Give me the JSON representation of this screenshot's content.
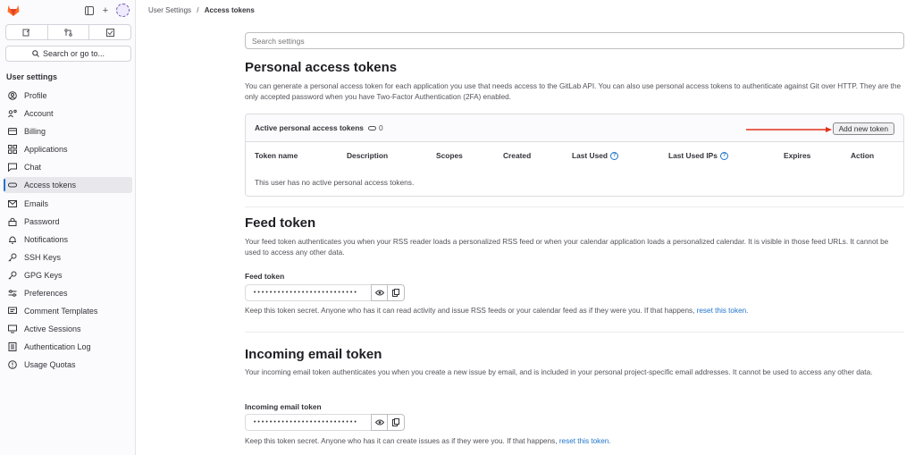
{
  "sidebar": {
    "search_label": "Search or go to...",
    "section_title": "User settings",
    "items": [
      {
        "label": "Profile",
        "icon": "profile-icon"
      },
      {
        "label": "Account",
        "icon": "account-icon"
      },
      {
        "label": "Billing",
        "icon": "billing-icon"
      },
      {
        "label": "Applications",
        "icon": "applications-icon"
      },
      {
        "label": "Chat",
        "icon": "chat-icon"
      },
      {
        "label": "Access tokens",
        "icon": "token-icon",
        "active": true
      },
      {
        "label": "Emails",
        "icon": "email-icon"
      },
      {
        "label": "Password",
        "icon": "lock-icon"
      },
      {
        "label": "Notifications",
        "icon": "bell-icon"
      },
      {
        "label": "SSH Keys",
        "icon": "key-icon"
      },
      {
        "label": "GPG Keys",
        "icon": "key-icon"
      },
      {
        "label": "Preferences",
        "icon": "preferences-icon"
      },
      {
        "label": "Comment Templates",
        "icon": "comment-icon"
      },
      {
        "label": "Active Sessions",
        "icon": "sessions-icon"
      },
      {
        "label": "Authentication Log",
        "icon": "log-icon"
      },
      {
        "label": "Usage Quotas",
        "icon": "quota-icon"
      }
    ]
  },
  "breadcrumb": {
    "parent": "User Settings",
    "separator": "/",
    "current": "Access tokens"
  },
  "search": {
    "placeholder": "Search settings"
  },
  "pat": {
    "title": "Personal access tokens",
    "description": "You can generate a personal access token for each application you use that needs access to the GitLab API. You can also use personal access tokens to authenticate against Git over HTTP. They are the only accepted password when you have Two-Factor Authentication (2FA) enabled.",
    "card_title": "Active personal access tokens",
    "count": "0",
    "add_button": "Add new token",
    "columns": [
      "Token name",
      "Description",
      "Scopes",
      "Created",
      "Last Used",
      "Last Used IPs",
      "Expires",
      "Action"
    ],
    "empty_text": "This user has no active personal access tokens."
  },
  "feed": {
    "title": "Feed token",
    "description": "Your feed token authenticates you when your RSS reader loads a personalized RSS feed or when your calendar application loads a personalized calendar. It is visible in those feed URLs. It cannot be used to access any other data.",
    "label": "Feed token",
    "masked_value": "••••••••••••••••••••••••••",
    "note": "Keep this token secret. Anyone who has it can read activity and issue RSS feeds or your calendar feed as if they were you. If that happens,",
    "link": "reset this token."
  },
  "incoming": {
    "title": "Incoming email token",
    "description": "Your incoming email token authenticates you when you create a new issue by email, and is included in your personal project-specific email addresses. It cannot be used to access any other data.",
    "label": "Incoming email token",
    "masked_value": "••••••••••••••••••••••••••",
    "note": "Keep this token secret. Anyone who has it can create issues as if they were you. If that happens,",
    "link": "reset this token."
  },
  "colors": {
    "accent": "#1f75cb",
    "arrow": "#e1301a",
    "logo": "#fc6d26"
  }
}
